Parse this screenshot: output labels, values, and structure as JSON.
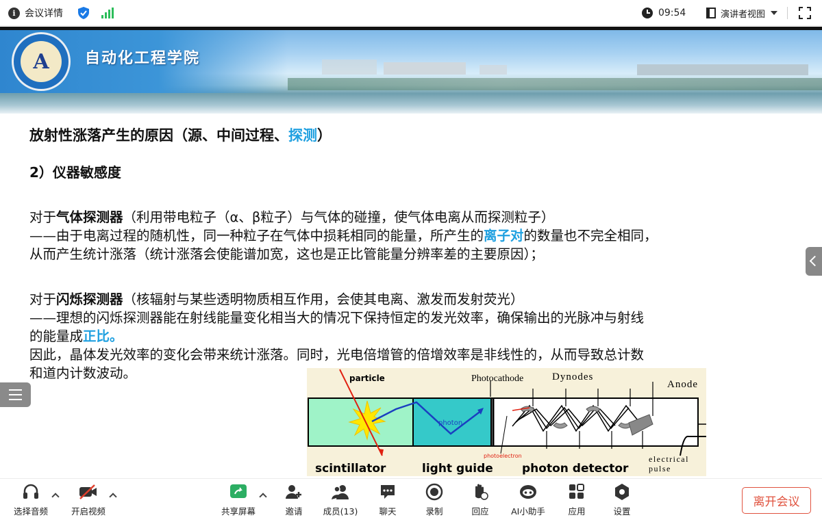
{
  "topbar": {
    "meeting_info_label": "会议详情",
    "time": "09:54",
    "view_label": "演讲者视图"
  },
  "slide": {
    "school_name": "自动化工程学院",
    "title_prefix": "放射性涨落产生的原因（源、中间过程、",
    "title_highlight": "探测",
    "title_suffix": "）",
    "subtitle": "2）仪器敏感度",
    "p1_l1_a": "对于",
    "p1_l1_bold": "气体探测器",
    "p1_l1_b": "（利用带电粒子（α、β粒子）与气体的碰撞，使气体电离从而探测粒子）",
    "p1_l2_a": "——由于电离过程的随机性，同一种粒子在气体中损耗相同的能量，所产生的",
    "p1_l2_hl": "离子对",
    "p1_l2_b": "的数量也不完全相同，",
    "p1_l3": "从而产生统计涨落（统计涨落会使能谱加宽，这也是正比管能量分辨率差的主要原因）；",
    "p2_l1_a": "对于",
    "p2_l1_bold": "闪烁探测器",
    "p2_l1_b": "（核辐射与某些透明物质相互作用，会使其电离、激发而发射荧光）",
    "p2_l2": "——理想的闪烁探测器能在射线能量变化相当大的情况下保持恒定的发光效率，确保输出的光脉冲与射线",
    "p2_l3_a": "的能量成",
    "p2_l3_hl": "正比。",
    "p2_l4": "因此，晶体发光效率的变化会带来统计涨落。同时，光电倍增管的倍增效率是非线性的，从而导致总计数",
    "p2_l5": "和道内计数波动。",
    "diagram": {
      "particle": "particle",
      "photon": "photon",
      "photocathode": "Photocathode",
      "dynodes": "Dynodes",
      "anode": "Anode",
      "photoelectron": "photoelectron",
      "scintillator": "scintillator",
      "light_guide": "light guide",
      "photon_detector": "photon detector",
      "electrical": "electrical",
      "pulse": "pulse"
    }
  },
  "toolbar": {
    "audio": "选择音频",
    "video": "开启视频",
    "share": "共享屏幕",
    "invite": "邀请",
    "members": "成员(13)",
    "chat": "聊天",
    "record": "录制",
    "react": "回应",
    "ai": "AI小助手",
    "apps": "应用",
    "settings": "设置",
    "leave": "离开会议"
  },
  "colors": {
    "highlight": "#1fa0e0",
    "leave": "#e0523e",
    "signal": "#2cbd5a",
    "shield": "#1a7ae6",
    "share": "#2cae63"
  }
}
